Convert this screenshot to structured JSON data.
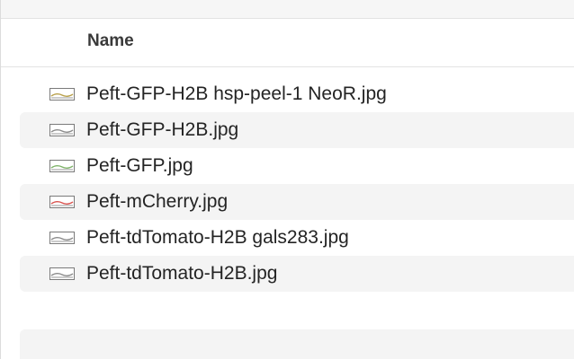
{
  "header": {
    "name_label": "Name"
  },
  "files": [
    {
      "name": "Peft-GFP-H2B hsp-peel-1 NeoR.jpg",
      "icon": "image-thumbnail-icon",
      "accent": "#b8a04a"
    },
    {
      "name": "Peft-GFP-H2B.jpg",
      "icon": "image-thumbnail-icon",
      "accent": "#8a8a8a"
    },
    {
      "name": "Peft-GFP.jpg",
      "icon": "image-thumbnail-icon",
      "accent": "#7fb36a"
    },
    {
      "name": "Peft-mCherry.jpg",
      "icon": "image-thumbnail-icon",
      "accent": "#d9534f"
    },
    {
      "name": "Peft-tdTomato-H2B gals283.jpg",
      "icon": "image-thumbnail-icon",
      "accent": "#8a8a8a"
    },
    {
      "name": "Peft-tdTomato-H2B.jpg",
      "icon": "image-thumbnail-icon",
      "accent": "#8a8a8a"
    }
  ]
}
